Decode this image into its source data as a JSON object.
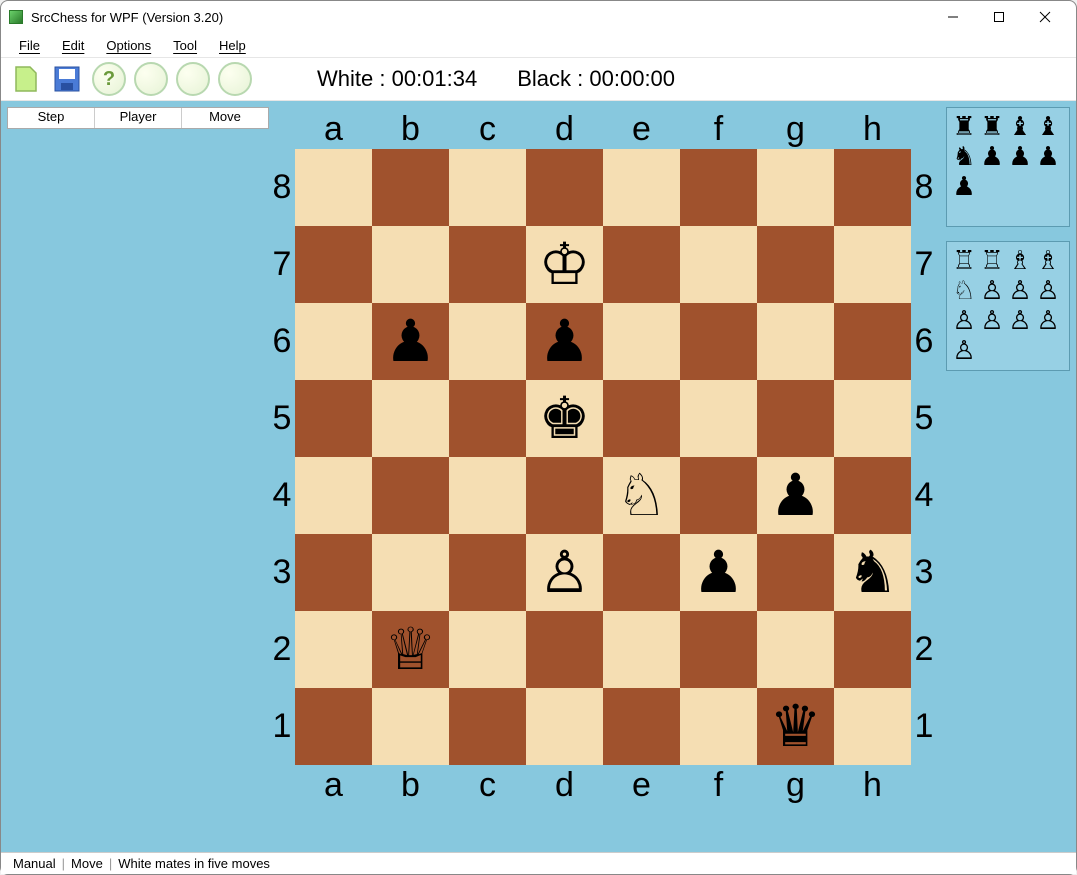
{
  "window": {
    "title": "SrcChess for WPF (Version 3.20)"
  },
  "menu": {
    "file": "File",
    "edit": "Edit",
    "options": "Options",
    "tool": "Tool",
    "help": "Help"
  },
  "toolbar": {
    "white_label": "White :",
    "white_time": "00:01:34",
    "black_label": "Black :",
    "black_time": "00:00:00"
  },
  "move_header": {
    "c1": "Step",
    "c2": "Player",
    "c3": "Move"
  },
  "files": [
    "a",
    "b",
    "c",
    "d",
    "e",
    "f",
    "g",
    "h"
  ],
  "ranks": [
    "8",
    "7",
    "6",
    "5",
    "4",
    "3",
    "2",
    "1"
  ],
  "board": {
    "d7": "♔",
    "b6": "♟",
    "d6": "♟",
    "d5": "♚",
    "e4": "♘",
    "g4": "♟",
    "d3": "♙",
    "f3": "♟",
    "h3": "♞",
    "b2": "♕",
    "g1": "♛"
  },
  "captured": {
    "black": [
      "♜",
      "♜",
      "♝",
      "♝",
      "♞",
      "♟",
      "♟",
      "♟",
      "♟"
    ],
    "white": [
      "♖",
      "♖",
      "♗",
      "♗",
      "♘",
      "♙",
      "♙",
      "♙",
      "♙",
      "♙",
      "♙",
      "♙",
      "♙"
    ]
  },
  "status": {
    "mode": "Manual",
    "phase": "Move",
    "msg": "White mates in five moves"
  }
}
